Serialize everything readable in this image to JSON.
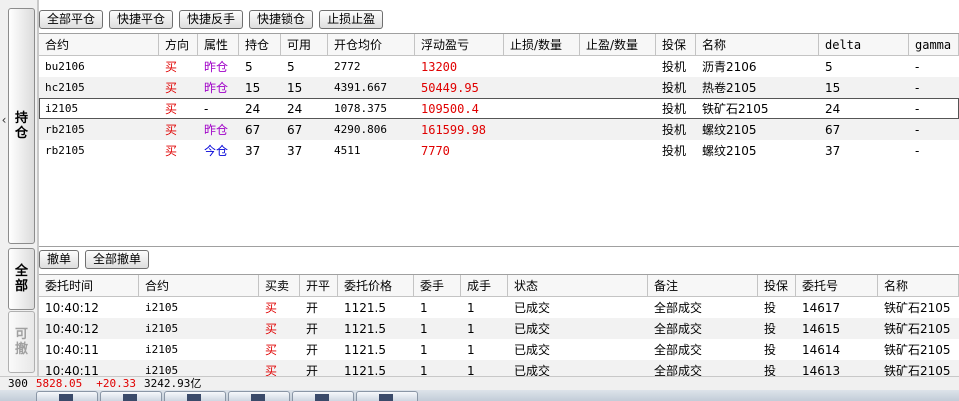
{
  "left_tabs": {
    "collapse_arrow": "‹",
    "hold_label": "持仓",
    "all_label": "全部",
    "cancelable_label": "可撤"
  },
  "top_toolbar": {
    "close_all": "全部平仓",
    "quick_close": "快捷平仓",
    "quick_reverse": "快捷反手",
    "quick_lock": "快捷锁仓",
    "stop_loss_profit": "止损止盈"
  },
  "positions": {
    "headers": [
      "合约",
      "方向",
      "属性",
      "持仓",
      "可用",
      "开仓均价",
      "浮动盈亏",
      "止损/数量",
      "止盈/数量",
      "投保",
      "名称",
      "delta",
      "gamma"
    ],
    "rows": [
      {
        "contract": "bu2106",
        "direction": "买",
        "attr": "昨仓",
        "hold": "5",
        "avail": "5",
        "avg_price": "2772",
        "pnl": "13200",
        "stop_loss": "",
        "take_profit": "",
        "hedge": "投机",
        "name": "沥青2106",
        "delta": "5",
        "gamma": "-"
      },
      {
        "contract": "hc2105",
        "direction": "买",
        "attr": "昨仓",
        "hold": "15",
        "avail": "15",
        "avg_price": "4391.667",
        "pnl": "50449.95",
        "stop_loss": "",
        "take_profit": "",
        "hedge": "投机",
        "name": "热卷2105",
        "delta": "15",
        "gamma": "-"
      },
      {
        "contract": "i2105",
        "direction": "买",
        "attr": "-",
        "hold": "24",
        "avail": "24",
        "avg_price": "1078.375",
        "pnl": "109500.4",
        "stop_loss": "",
        "take_profit": "",
        "hedge": "投机",
        "name": "铁矿石2105",
        "delta": "24",
        "gamma": "-"
      },
      {
        "contract": "rb2105",
        "direction": "买",
        "attr": "昨仓",
        "hold": "67",
        "avail": "67",
        "avg_price": "4290.806",
        "pnl": "161599.98",
        "stop_loss": "",
        "take_profit": "",
        "hedge": "投机",
        "name": "螺纹2105",
        "delta": "67",
        "gamma": "-"
      },
      {
        "contract": "rb2105",
        "direction": "买",
        "attr": "今仓",
        "hold": "37",
        "avail": "37",
        "avg_price": "4511",
        "pnl": "7770",
        "stop_loss": "",
        "take_profit": "",
        "hedge": "投机",
        "name": "螺纹2105",
        "delta": "37",
        "gamma": "-"
      }
    ]
  },
  "order_toolbar": {
    "cancel": "撤单",
    "cancel_all": "全部撤单"
  },
  "orders": {
    "headers": [
      "委托时间",
      "合约",
      "买卖",
      "开平",
      "委托价格",
      "委手",
      "成手",
      "状态",
      "备注",
      "投保",
      "委托号",
      "名称"
    ],
    "rows": [
      {
        "time": "10:40:12",
        "contract": "i2105",
        "side": "买",
        "open_close": "开",
        "price": "1121.5",
        "qty": "1",
        "filled": "1",
        "status": "已成交",
        "note": "全部成交",
        "hedge": "投",
        "order_no": "14617",
        "name": "铁矿石2105"
      },
      {
        "time": "10:40:12",
        "contract": "i2105",
        "side": "买",
        "open_close": "开",
        "price": "1121.5",
        "qty": "1",
        "filled": "1",
        "status": "已成交",
        "note": "全部成交",
        "hedge": "投",
        "order_no": "14615",
        "name": "铁矿石2105"
      },
      {
        "time": "10:40:11",
        "contract": "i2105",
        "side": "买",
        "open_close": "开",
        "price": "1121.5",
        "qty": "1",
        "filled": "1",
        "status": "已成交",
        "note": "全部成交",
        "hedge": "投",
        "order_no": "14614",
        "name": "铁矿石2105"
      },
      {
        "time": "10:40:11",
        "contract": "i2105",
        "side": "买",
        "open_close": "开",
        "price": "1121.5",
        "qty": "1",
        "filled": "1",
        "status": "已成交",
        "note": "全部成交",
        "hedge": "投",
        "order_no": "14613",
        "name": "铁矿石2105"
      }
    ]
  },
  "status_bar": {
    "index_code": "300",
    "index_value": "5828.05",
    "index_change": "+20.33",
    "turnover": "3242.93亿"
  },
  "colors": {
    "buy": "#e00000",
    "yesterday_position": "#a000c8",
    "today_position": "#0000d8",
    "pnl": "#e00000"
  }
}
